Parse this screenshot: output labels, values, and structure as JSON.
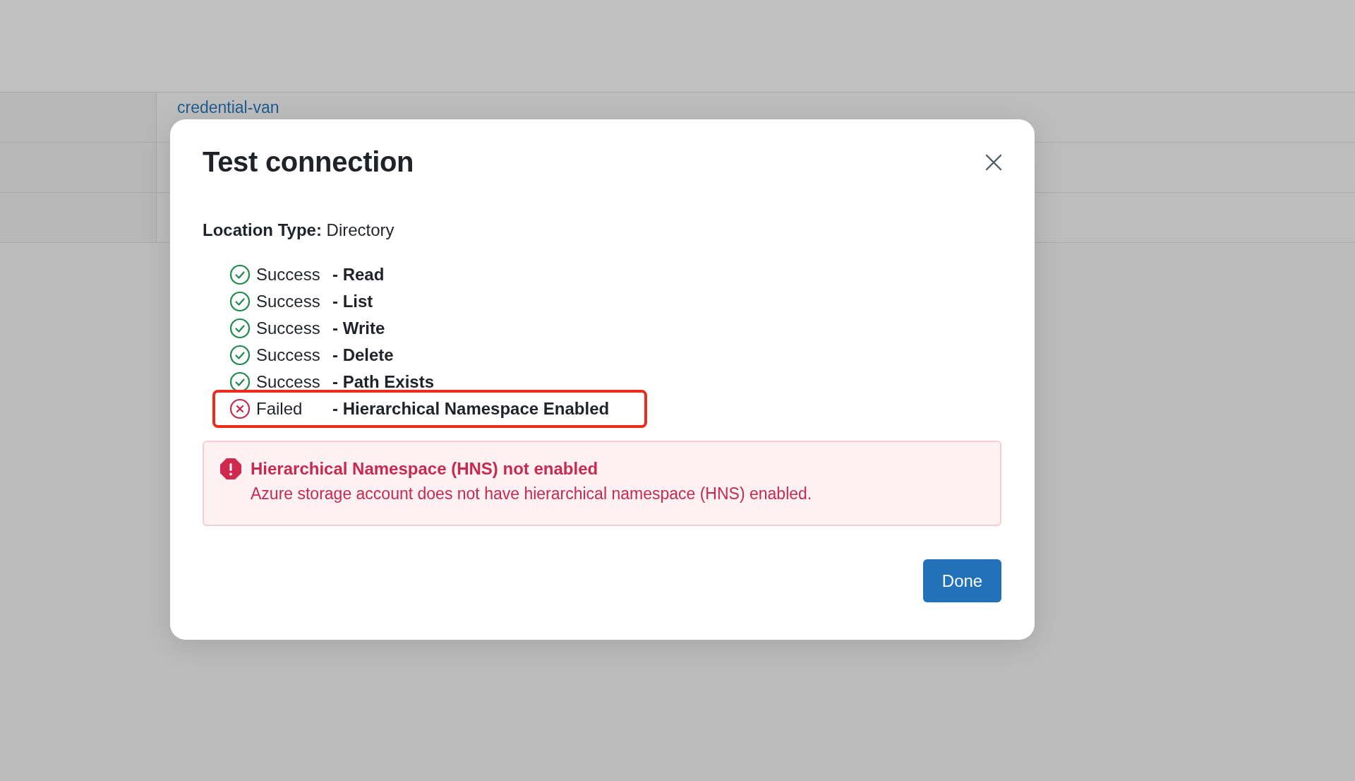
{
  "background_table": {
    "rows": [
      {
        "cell": "credential-van"
      },
      {
        "cell": ""
      },
      {
        "cell": ""
      }
    ]
  },
  "dialog": {
    "title": "Test connection",
    "location_type": {
      "label": "Location Type:",
      "value": "Directory"
    },
    "checks": [
      {
        "kind": "success",
        "status": "Success",
        "name": "- Read",
        "highlighted": false
      },
      {
        "kind": "success",
        "status": "Success",
        "name": "- List",
        "highlighted": false
      },
      {
        "kind": "success",
        "status": "Success",
        "name": "- Write",
        "highlighted": false
      },
      {
        "kind": "success",
        "status": "Success",
        "name": "- Delete",
        "highlighted": false
      },
      {
        "kind": "success",
        "status": "Success",
        "name": "- Path Exists",
        "highlighted": false
      },
      {
        "kind": "failed",
        "status": "Failed",
        "name": "- Hierarchical Namespace Enabled",
        "highlighted": true
      }
    ],
    "alert": {
      "title": "Hierarchical Namespace (HNS) not enabled",
      "message": "Azure storage account does not have hierarchical namespace (HNS) enabled."
    },
    "buttons": [
      "Done"
    ]
  }
}
